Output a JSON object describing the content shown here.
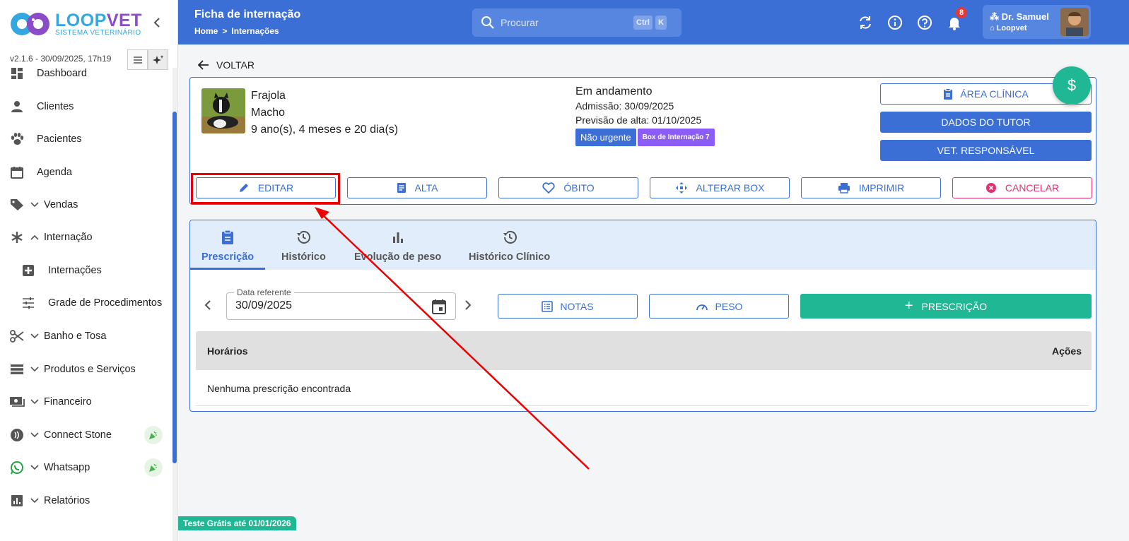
{
  "brand": {
    "name_part1": "LOOP",
    "name_part2": "VET",
    "subtitle": "SISTEMA VETERINÁRIO",
    "primary": "#3b6fd6",
    "accent": "#20b894",
    "logo_purple": "#8b4cc7",
    "logo_blue": "#35a7e0"
  },
  "sidebar": {
    "version": "v2.1.6 - 30/09/2025, 17h19",
    "items": [
      {
        "label": "Dashboard",
        "icon": "dashboard-icon"
      },
      {
        "label": "Clientes",
        "icon": "person-icon"
      },
      {
        "label": "Pacientes",
        "icon": "paw-icon"
      },
      {
        "label": "Agenda",
        "icon": "calendar-icon"
      },
      {
        "label": "Vendas",
        "icon": "tag-icon"
      },
      {
        "label": "Internação",
        "icon": "asterisk-icon"
      },
      {
        "label": "Internações",
        "icon": "hospital-icon"
      },
      {
        "label": "Grade de Procedimentos",
        "icon": "sliders-icon"
      },
      {
        "label": "Banho e Tosa",
        "icon": "scissors-icon"
      },
      {
        "label": "Produtos e Serviços",
        "icon": "storage-icon"
      },
      {
        "label": "Financeiro",
        "icon": "money-icon"
      },
      {
        "label": "Connect Stone",
        "icon": "contactless-icon"
      },
      {
        "label": "Whatsapp",
        "icon": "whatsapp-icon"
      },
      {
        "label": "Relatórios",
        "icon": "chart-icon"
      }
    ],
    "trial": "Teste Grátis até 01/01/2026"
  },
  "header": {
    "title": "Ficha de internação",
    "breadcrumb": [
      "Home",
      ">",
      "Internações"
    ],
    "search_placeholder": "Procurar",
    "kbd": [
      "Ctrl",
      "K"
    ],
    "notifications": "8",
    "user_name": "Dr. Samuel",
    "user_org": "Loopvet"
  },
  "page": {
    "back": "VOLTAR",
    "pet": {
      "name": "Frajola",
      "sex": "Macho",
      "age": "9 ano(s), 4 meses e 20 dia(s)"
    },
    "status": {
      "state": "Em andamento",
      "admission": "Admissão: 30/09/2025",
      "discharge": "Previsão de alta: 01/10/2025",
      "priority": "Não urgente",
      "box": "Box de Internação 7"
    },
    "right_buttons": {
      "clinical": "ÁREA CLÍNICA",
      "tutor": "DADOS DO TUTOR",
      "vet": "VET. RESPONSÁVEL"
    },
    "fab": "$",
    "actions": {
      "edit": "EDITAR",
      "discharge": "ALTA",
      "death": "ÓBITO",
      "change_box": "ALTERAR BOX",
      "print": "IMPRIMIR",
      "cancel": "CANCELAR"
    },
    "tabs": [
      "Prescrição",
      "Histórico",
      "Evolução de peso",
      "Histórico Clínico"
    ],
    "date_label": "Data referente",
    "date_value": "30/09/2025",
    "notes": "NOTAS",
    "weight": "PESO",
    "prescription": "PRESCRIÇÃO",
    "table_headers": [
      "Horários",
      "Ações"
    ],
    "empty": "Nenhuma prescrição encontrada"
  }
}
